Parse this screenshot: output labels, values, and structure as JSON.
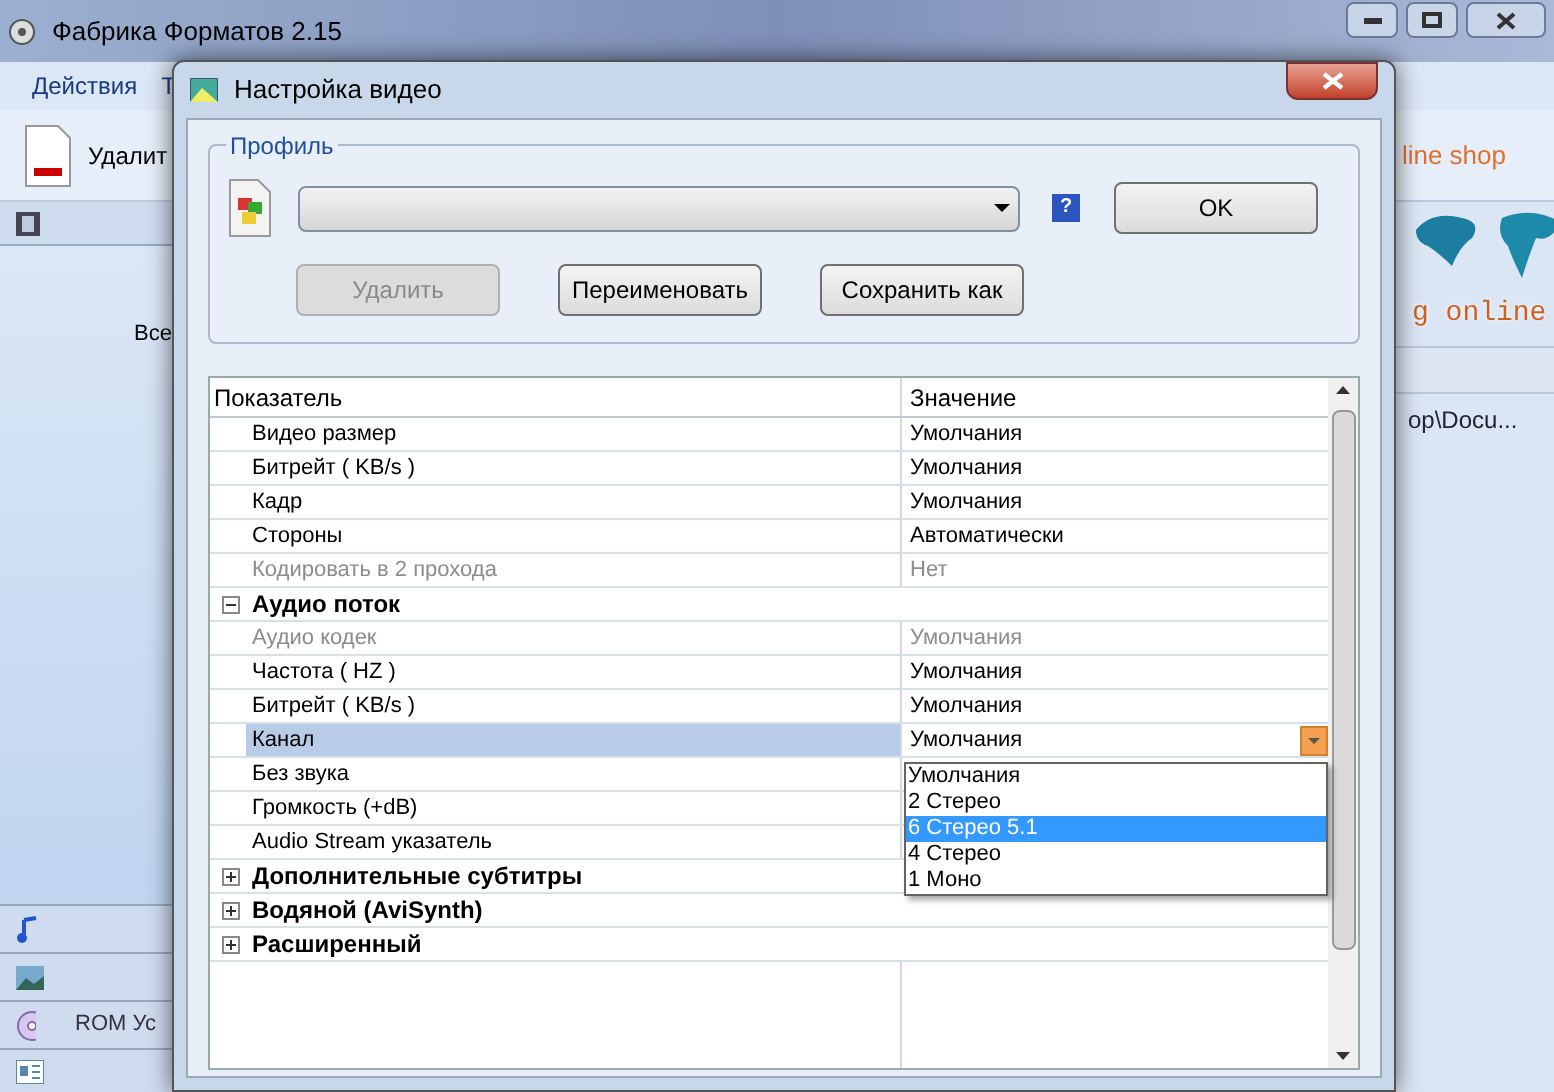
{
  "main_window": {
    "title": "Фабрика Форматов 2.15",
    "menu": [
      "Действия",
      "Т"
    ],
    "toolbar_label": "Удалит",
    "banner_top": "line shop",
    "banner_bottom": "g online",
    "sidebar_label": "Все",
    "path_text": "op\\Docu...",
    "sidebar_item": "ROM Ус"
  },
  "dialog": {
    "title": "Настройка видео",
    "profile": {
      "legend": "Профиль",
      "help": "?",
      "ok": "OK",
      "buttons": [
        {
          "label": "Удалить",
          "disabled": true
        },
        {
          "label": "Переименовать",
          "disabled": false
        },
        {
          "label": "Сохранить как",
          "disabled": false
        }
      ]
    },
    "grid": {
      "columns": [
        "Показатель",
        "Значение"
      ],
      "rows": [
        {
          "kind": "property",
          "name": "Видео размер",
          "value": "Умолчания",
          "disabled": false,
          "selected": false
        },
        {
          "kind": "property",
          "name": "Битрейт ( KB/s )",
          "value": "Умолчания",
          "disabled": false,
          "selected": false
        },
        {
          "kind": "property",
          "name": "Кадр",
          "value": "Умолчания",
          "disabled": false,
          "selected": false
        },
        {
          "kind": "property",
          "name": "Стороны",
          "value": "Автоматически",
          "disabled": false,
          "selected": false
        },
        {
          "kind": "property",
          "name": "Кодировать в 2 прохода",
          "value": "Нет",
          "disabled": true,
          "selected": false
        },
        {
          "kind": "group",
          "name": "Аудио поток",
          "expanded": true
        },
        {
          "kind": "property",
          "name": "Аудио кодек",
          "value": "Умолчания",
          "disabled": true,
          "selected": false
        },
        {
          "kind": "property",
          "name": "Частота ( HZ )",
          "value": "Умолчания",
          "disabled": false,
          "selected": false
        },
        {
          "kind": "property",
          "name": "Битрейт ( KB/s )",
          "value": "Умолчания",
          "disabled": false,
          "selected": false
        },
        {
          "kind": "property",
          "name": "Канал",
          "value": "Умолчания",
          "disabled": false,
          "selected": true
        },
        {
          "kind": "property",
          "name": "Без звука",
          "disabled": false,
          "selected": false
        },
        {
          "kind": "property",
          "name": "Громкость (+dB)",
          "disabled": false,
          "selected": false
        },
        {
          "kind": "property",
          "name": "Audio Stream указатель",
          "disabled": false,
          "selected": false
        },
        {
          "kind": "group",
          "name": "Дополнительные субтитры",
          "expanded": false
        },
        {
          "kind": "group",
          "name": "Водяной (AviSynth)",
          "expanded": false
        },
        {
          "kind": "group",
          "name": "Расширенный",
          "expanded": false
        }
      ],
      "dropdown": [
        {
          "label": "Умолчания",
          "selected": false
        },
        {
          "label": "2 Стерео",
          "selected": false
        },
        {
          "label": "6 Стерео 5.1",
          "selected": true
        },
        {
          "label": "4 Стерео",
          "selected": false
        },
        {
          "label": "1 Моно",
          "selected": false
        }
      ]
    }
  }
}
